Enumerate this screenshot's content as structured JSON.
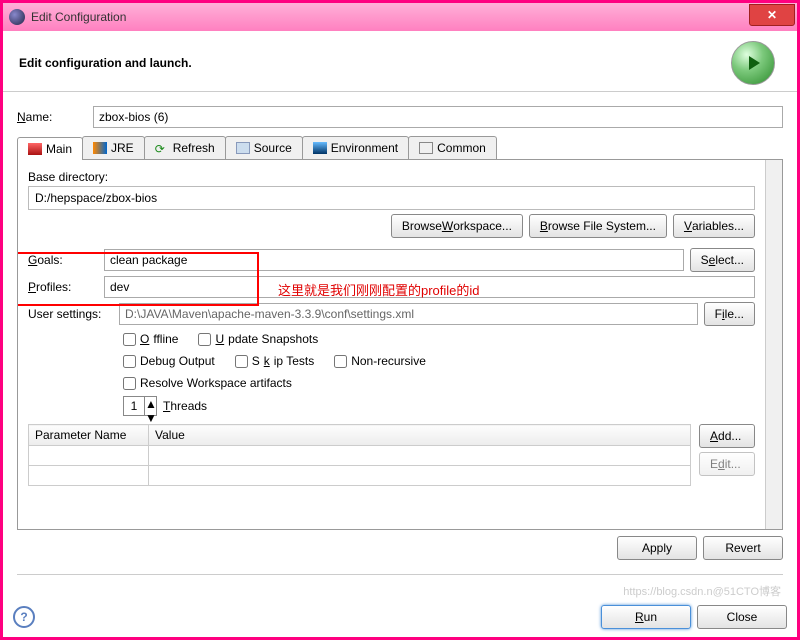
{
  "window": {
    "title": "Edit Configuration"
  },
  "header": {
    "subtitle": "Edit configuration and launch."
  },
  "name": {
    "label": "Name:",
    "value": "zbox-bios (6)"
  },
  "tabs": [
    {
      "label": "Main"
    },
    {
      "label": "JRE"
    },
    {
      "label": "Refresh"
    },
    {
      "label": "Source"
    },
    {
      "label": "Environment"
    },
    {
      "label": "Common"
    }
  ],
  "basedir": {
    "label": "Base directory:",
    "value": "D:/hepspace/zbox-bios"
  },
  "buttons": {
    "browse_ws": "Browse Workspace...",
    "browse_fs": "Browse File System...",
    "variables": "Variables...",
    "select": "Select...",
    "file": "File...",
    "apply": "Apply",
    "revert": "Revert",
    "run": "Run",
    "close": "Close",
    "add": "Add...",
    "edit": "Edit..."
  },
  "goals": {
    "label": "Goals:",
    "value": "clean package"
  },
  "profiles": {
    "label": "Profiles:",
    "value": "dev"
  },
  "annotation": "这里就是我们刚刚配置的profile的id",
  "usersettings": {
    "label": "User settings:",
    "value": "D:\\JAVA\\Maven\\apache-maven-3.3.9\\conf\\settings.xml"
  },
  "checks": {
    "offline": "Offline",
    "update": "Update Snapshots",
    "debug": "Debug Output",
    "skip": "Skip Tests",
    "nonrec": "Non-recursive",
    "resolve": "Resolve Workspace artifacts"
  },
  "threads": {
    "value": "1",
    "label": "Threads"
  },
  "table": {
    "col1": "Parameter Name",
    "col2": "Value"
  },
  "watermark": "https://blog.csdn.n@51CTO博客"
}
